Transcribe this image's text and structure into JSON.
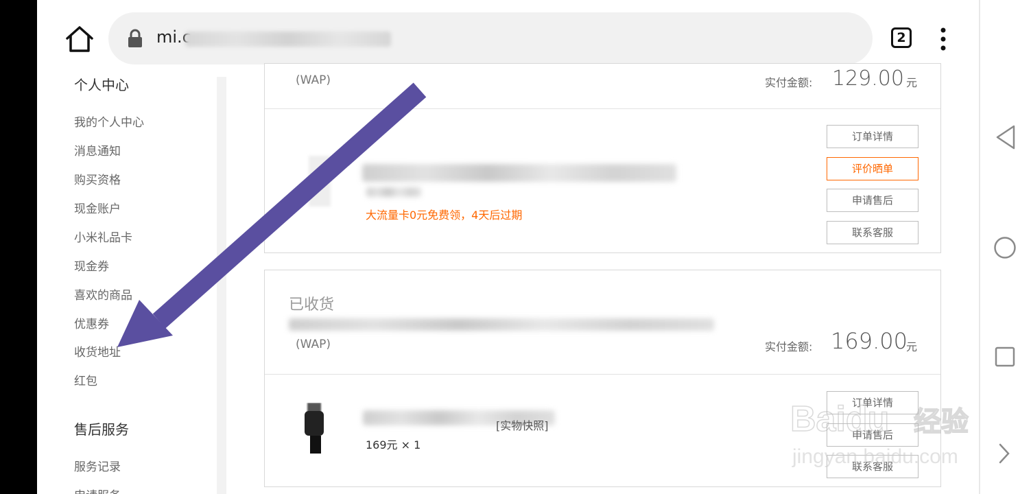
{
  "browser": {
    "url_prefix": "mi.c",
    "tab_count": "2"
  },
  "sidebar": {
    "section1_title": "个人中心",
    "items": [
      "我的个人中心",
      "消息通知",
      "购买资格",
      "现金账户",
      "小米礼品卡",
      "现金券",
      "喜欢的商品",
      "优惠券",
      "收货地址",
      "红包"
    ],
    "section2_title": "售后服务",
    "items2": [
      "服务记录",
      "申请服务"
    ]
  },
  "orders": [
    {
      "channel": "(WAP)",
      "amount_label": "实付金额:",
      "amount_value": "129.00",
      "currency": "元",
      "promo_text": "大流量卡0元免费领，4天后过期",
      "buttons": [
        "订单详情",
        "评价晒单",
        "申请售后",
        "联系客服"
      ]
    },
    {
      "status": "已收货",
      "channel": "(WAP)",
      "amount_label": "实付金额:",
      "amount_value": "169.00",
      "currency": "元",
      "product_suffix": "[实物快照]",
      "price_qty": "169元 × 1",
      "buttons": [
        "订单详情",
        "申请售后",
        "联系客服"
      ]
    }
  ],
  "watermark": {
    "brand": "Baidu",
    "brand_cn": "经验",
    "url": "jingyan.baidu.com"
  },
  "colors": {
    "accent": "#ff6700",
    "annotation_arrow": "#5a4fa0"
  },
  "icons": [
    "home-icon",
    "lock-icon",
    "tab-switcher-icon",
    "more-vert-icon",
    "back-icon",
    "home-circle-icon",
    "recent-apps-icon",
    "chevron-right-icon"
  ]
}
